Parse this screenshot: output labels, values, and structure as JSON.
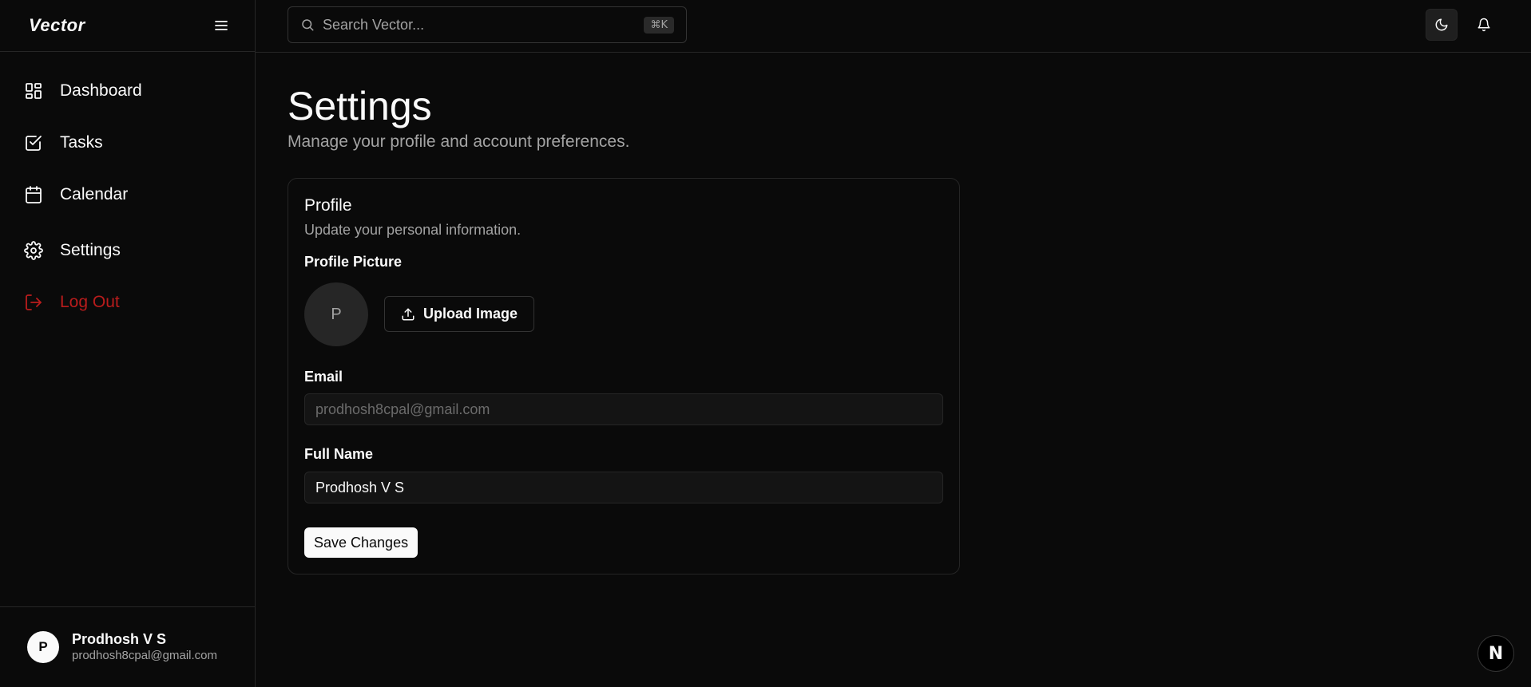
{
  "app": {
    "logo": "Vector"
  },
  "sidebar": {
    "items": [
      {
        "label": "Dashboard",
        "icon": "dashboard-icon"
      },
      {
        "label": "Tasks",
        "icon": "tasks-icon"
      },
      {
        "label": "Calendar",
        "icon": "calendar-icon"
      },
      {
        "label": "Settings",
        "icon": "gear-icon"
      },
      {
        "label": "Log Out",
        "icon": "logout-icon"
      }
    ],
    "user": {
      "initial": "P",
      "name": "Prodhosh V S",
      "email": "prodhosh8cpal@gmail.com"
    }
  },
  "topbar": {
    "search_placeholder": "Search Vector...",
    "shortcut": "⌘K"
  },
  "page": {
    "title": "Settings",
    "subtitle": "Manage your profile and account preferences."
  },
  "profile": {
    "title": "Profile",
    "description": "Update your personal information.",
    "picture_label": "Profile Picture",
    "avatar_initial": "P",
    "upload_label": "Upload Image",
    "email_label": "Email",
    "email_value": "prodhosh8cpal@gmail.com",
    "name_label": "Full Name",
    "name_value": "Prodhosh V S",
    "save_label": "Save Changes"
  },
  "badge": {
    "letter": "N"
  },
  "colors": {
    "accent": "#fafafa",
    "danger": "#b91c1c",
    "background": "#0a0a0a",
    "border": "#262626"
  }
}
